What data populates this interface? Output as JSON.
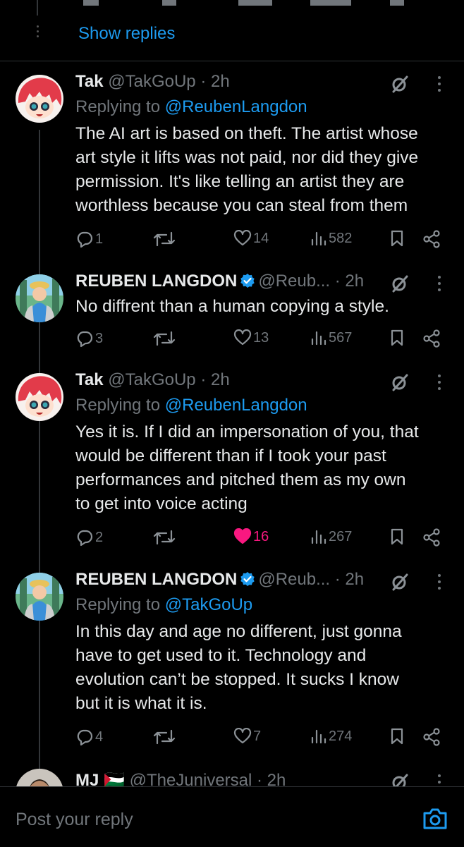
{
  "top": {
    "show_replies": "Show replies"
  },
  "tweets": [
    {
      "name": "Tak",
      "handle": "@TakGoUp",
      "time": "· 2h",
      "verified": false,
      "replying_label": "Replying to ",
      "replying_to": "@ReubenLangdon",
      "lines": [
        "The AI art is based on theft. The artist whose",
        "art style it lifts was not paid, nor did they give",
        "permission. It's like telling an artist they are",
        "worthless because you can steal from them"
      ],
      "replies": "1",
      "retweets": "",
      "likes": "14",
      "liked": false,
      "views": "582"
    },
    {
      "name": "REUBEN LANGDON",
      "handle": "@Reub...",
      "time": "· 2h",
      "verified": true,
      "lines": [
        "No diffrent than a human copying a style."
      ],
      "replies": "3",
      "retweets": "",
      "likes": "13",
      "liked": false,
      "views": "567"
    },
    {
      "name": "Tak",
      "handle": "@TakGoUp",
      "time": "· 2h",
      "verified": false,
      "replying_label": "Replying to ",
      "replying_to": "@ReubenLangdon",
      "lines": [
        "Yes it is. If I did an impersonation of you, that",
        "would be different than if I took your past",
        "performances and pitched them as my own",
        "to get into voice acting"
      ],
      "replies": "2",
      "retweets": "",
      "likes": "16",
      "liked": true,
      "views": "267"
    },
    {
      "name": "REUBEN LANGDON",
      "handle": "@Reub...",
      "time": "· 2h",
      "verified": true,
      "replying_label": "Replying to ",
      "replying_to": "@TakGoUp",
      "lines": [
        "In this day and age no different, just gonna",
        "have to get used to it. Technology and",
        "evolution can’t be stopped. It sucks I know",
        "but it is what it is."
      ],
      "replies": "4",
      "retweets": "",
      "likes": "7",
      "liked": false,
      "views": "274"
    },
    {
      "name": "MJ",
      "flag": "🇵🇸",
      "handle": "@TheJuniversal",
      "time": "· 2h",
      "verified": false
    }
  ],
  "composer": {
    "placeholder": "Post your reply"
  },
  "colors": {
    "background": "#000000",
    "text": "#e7e9ea",
    "muted": "#71767b",
    "link": "#1d9bf0",
    "like": "#f91880",
    "verified": "#1d9bf0"
  },
  "icons": [
    "reply-icon",
    "retweet-icon",
    "heart-icon",
    "views-icon",
    "bookmark-icon",
    "share-icon",
    "grok-icon",
    "more-icon",
    "verified-icon",
    "camera-icon"
  ]
}
